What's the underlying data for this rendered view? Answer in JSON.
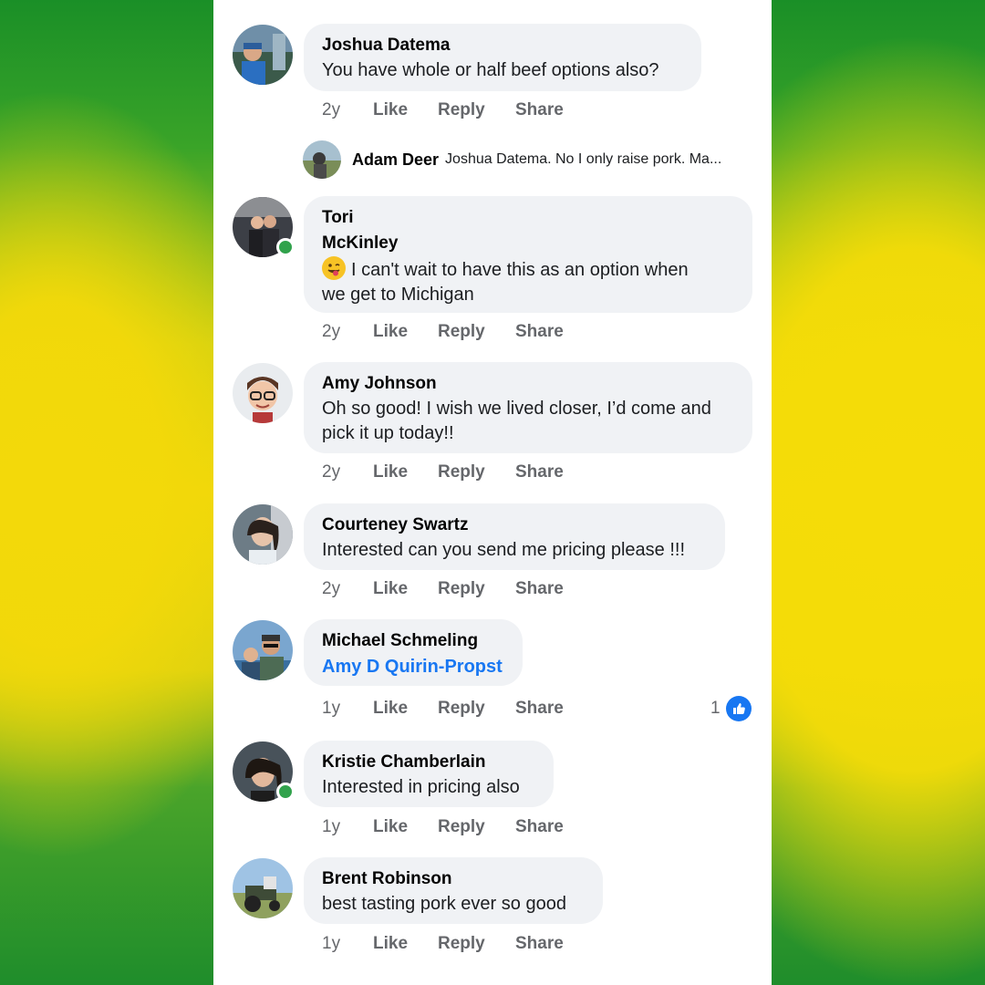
{
  "comments": [
    {
      "author": "Joshua Datema",
      "text": "You have whole or half beef options also?",
      "time": "2y"
    },
    {
      "author_line1": "Tori",
      "author_line2": "McKinley",
      "text_line1": "I can't wait to have this as an option when",
      "text_line2": "we get to Michigan",
      "time": "2y",
      "online": true
    },
    {
      "author": "Amy Johnson",
      "text_line1": "Oh so good! I wish we lived closer, I’d come and",
      "text_line2": "pick it up today!!",
      "time": "2y"
    },
    {
      "author": "Courteney Swartz",
      "text": "Interested can you send me pricing please !!!",
      "time": "2y"
    },
    {
      "author": "Michael Schmeling",
      "mention": "Amy D Quirin-Propst",
      "time": "1y",
      "reaction_count": "1"
    },
    {
      "author": "Kristie Chamberlain",
      "text": "Interested in pricing also",
      "time": "1y",
      "online": true
    },
    {
      "author": "Brent Robinson",
      "text": "best tasting pork ever so good",
      "time": "1y"
    }
  ],
  "reply": {
    "author": "Adam Deer",
    "text": "Joshua Datema. No I only raise pork. Ma..."
  },
  "actions": {
    "like": "Like",
    "reply": "Reply",
    "share": "Share"
  },
  "colors": {
    "link": "#1877f2",
    "online": "#31a24c",
    "bubble": "#f0f2f5",
    "meta": "#65676b"
  }
}
